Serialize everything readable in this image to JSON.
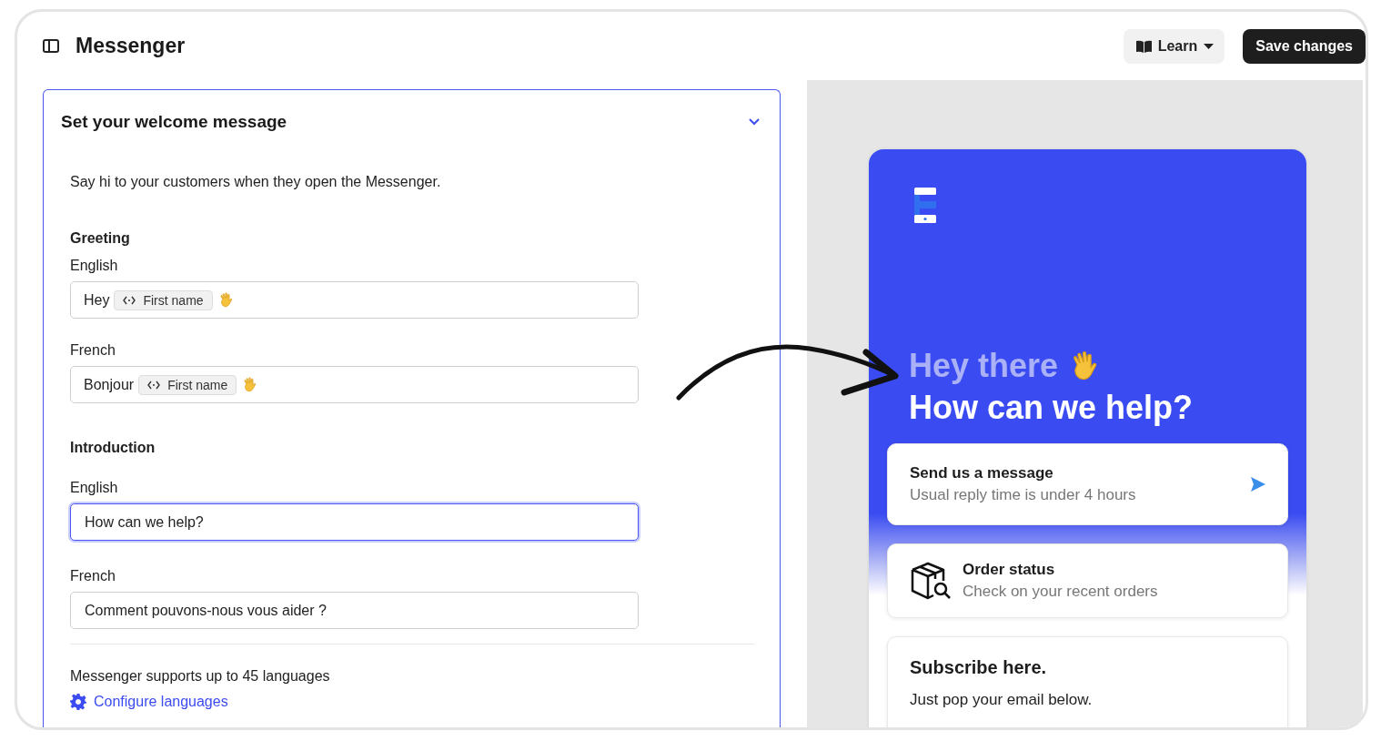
{
  "header": {
    "title": "Messenger",
    "learn_button": "Learn",
    "save_button": "Save changes"
  },
  "section": {
    "title": "Set your welcome message",
    "expanded": true,
    "description": "Say hi to your customers when they open the Messenger.",
    "greeting": {
      "heading": "Greeting",
      "fields": [
        {
          "language": "English",
          "prefix": "Hey",
          "chip": "First name"
        },
        {
          "language": "French",
          "prefix": "Bonjour",
          "chip": "First name"
        }
      ]
    },
    "introduction": {
      "heading": "Introduction",
      "fields": [
        {
          "language": "English",
          "value": "How can we help?",
          "focused": true
        },
        {
          "language": "French",
          "value": "Comment pouvons-nous vous aider ?",
          "focused": false
        }
      ]
    },
    "languages_note": "Messenger supports up to 45 languages",
    "configure_link": "Configure languages"
  },
  "preview": {
    "greeting": "Hey there",
    "headline": "How can we help?",
    "cards": [
      {
        "kind": "action",
        "title": "Send us a message",
        "subtitle": "Usual reply time is under 4 hours"
      },
      {
        "kind": "app",
        "title": "Order status",
        "subtitle": "Check on your recent orders"
      },
      {
        "kind": "form",
        "title": "Subscribe here.",
        "subtitle": "Just pop your email below."
      }
    ]
  }
}
